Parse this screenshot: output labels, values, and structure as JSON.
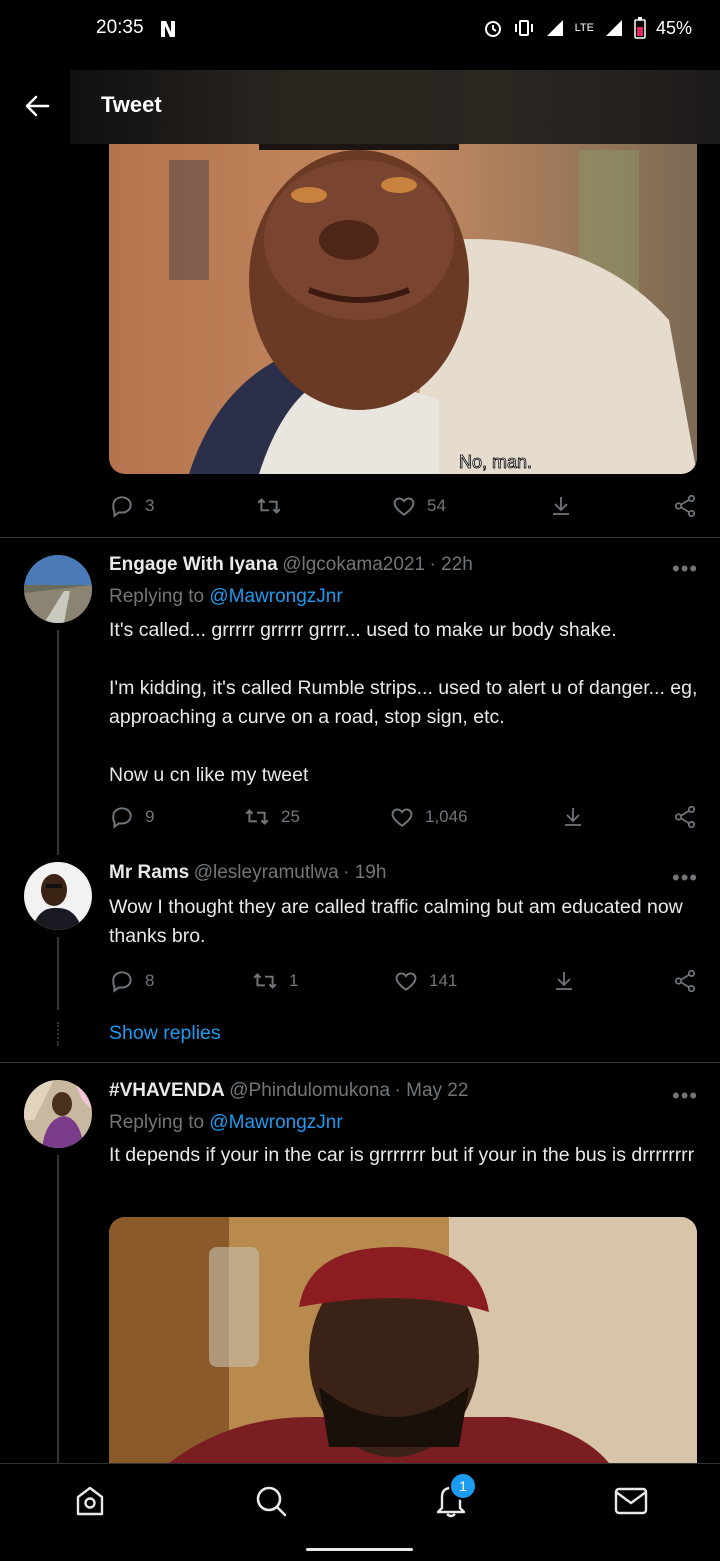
{
  "status_bar": {
    "time": "20:35",
    "network": "LTE",
    "battery": "45%"
  },
  "header": {
    "title": "Tweet"
  },
  "top_tweet": {
    "media_caption": "No, man.",
    "replies": "3",
    "retweets": "",
    "likes": "54"
  },
  "replies": [
    {
      "name": "Engage With Iyana",
      "handle": "@lgcokama2021",
      "time": "· 22h",
      "replying_to_label": "Replying to",
      "replying_to": "@MawrongzJnr",
      "text": "It's called... grrrrr grrrrr grrrr... used to make ur body shake.\n\nI'm kidding, it's called Rumble strips... used to alert u of danger... eg, approaching a curve on a road, stop sign, etc.\n\nNow u cn like my tweet",
      "replies": "9",
      "retweets": "25",
      "likes": "1,046"
    },
    {
      "name": "Mr Rams",
      "handle": "@lesleyramutlwa",
      "time": "· 19h",
      "text": "Wow I thought they are called traffic calming but am educated now thanks bro.",
      "replies": "8",
      "retweets": "1",
      "likes": "141",
      "show_replies": "Show replies"
    },
    {
      "name": "#VHAVENDA",
      "handle": "@Phindulomukona",
      "time": "· May 22",
      "replying_to_label": "Replying to",
      "replying_to": "@MawrongzJnr",
      "text": "It depends if your in the car is grrrrrrr but if your in the bus is drrrrrrrr"
    }
  ],
  "bottom_nav": {
    "notification_count": "1"
  },
  "colors": {
    "accent": "#1d9bf0",
    "secondary_text": "#71767b",
    "background": "#000000"
  }
}
